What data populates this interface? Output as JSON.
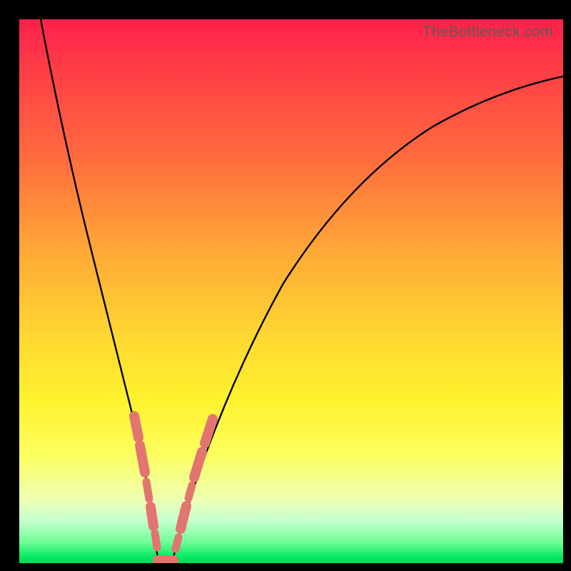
{
  "watermark": "TheBottleneck.com",
  "colors": {
    "frame": "#000000",
    "curve": "#000000",
    "markers": "#e2756f",
    "gradient_stops": [
      {
        "pct": 0,
        "hex": "#ff1f4b"
      },
      {
        "pct": 8,
        "hex": "#ff3a47"
      },
      {
        "pct": 25,
        "hex": "#ff6a3e"
      },
      {
        "pct": 42,
        "hex": "#ffa637"
      },
      {
        "pct": 58,
        "hex": "#ffd732"
      },
      {
        "pct": 70,
        "hex": "#fff22e"
      },
      {
        "pct": 80,
        "hex": "#fdff5f"
      },
      {
        "pct": 88,
        "hex": "#efffb0"
      },
      {
        "pct": 92,
        "hex": "#c8ffcf"
      },
      {
        "pct": 96,
        "hex": "#74ff9a"
      },
      {
        "pct": 99,
        "hex": "#00e85e"
      },
      {
        "pct": 100,
        "hex": "#00d85a"
      }
    ]
  },
  "chart_data": {
    "type": "line",
    "title": "",
    "xlabel": "",
    "ylabel": "",
    "xlim": [
      0,
      100
    ],
    "ylim": [
      0,
      100
    ],
    "note": "Axes are unlabeled; values are normalized 0–100 across the visible plot area. y≈100 is the top (red), y≈0 is the bottom (green). The curve is a V/checkmark-shaped bottleneck curve whose minimum sits near x≈25, y≈0.",
    "series": [
      {
        "name": "bottleneck-curve",
        "x": [
          4,
          6,
          8,
          10,
          12,
          14,
          16,
          18,
          20,
          22,
          23.5,
          25,
          27,
          29,
          32,
          36,
          41,
          47,
          54,
          62,
          71,
          81,
          91,
          100
        ],
        "y": [
          100,
          89,
          78,
          68,
          58,
          48,
          39,
          30,
          21,
          12,
          6,
          0,
          0,
          4,
          11,
          21,
          33,
          46,
          58,
          68,
          76,
          82,
          86,
          89
        ]
      }
    ],
    "marker_clusters": {
      "note": "Salmon rounded-rectangle markers overlaid on the curve near the bottom of the V.",
      "left_arm_y_range": [
        6,
        30
      ],
      "right_arm_y_range": [
        4,
        28
      ],
      "bottom_flat_x_range": [
        23.5,
        28
      ]
    }
  }
}
